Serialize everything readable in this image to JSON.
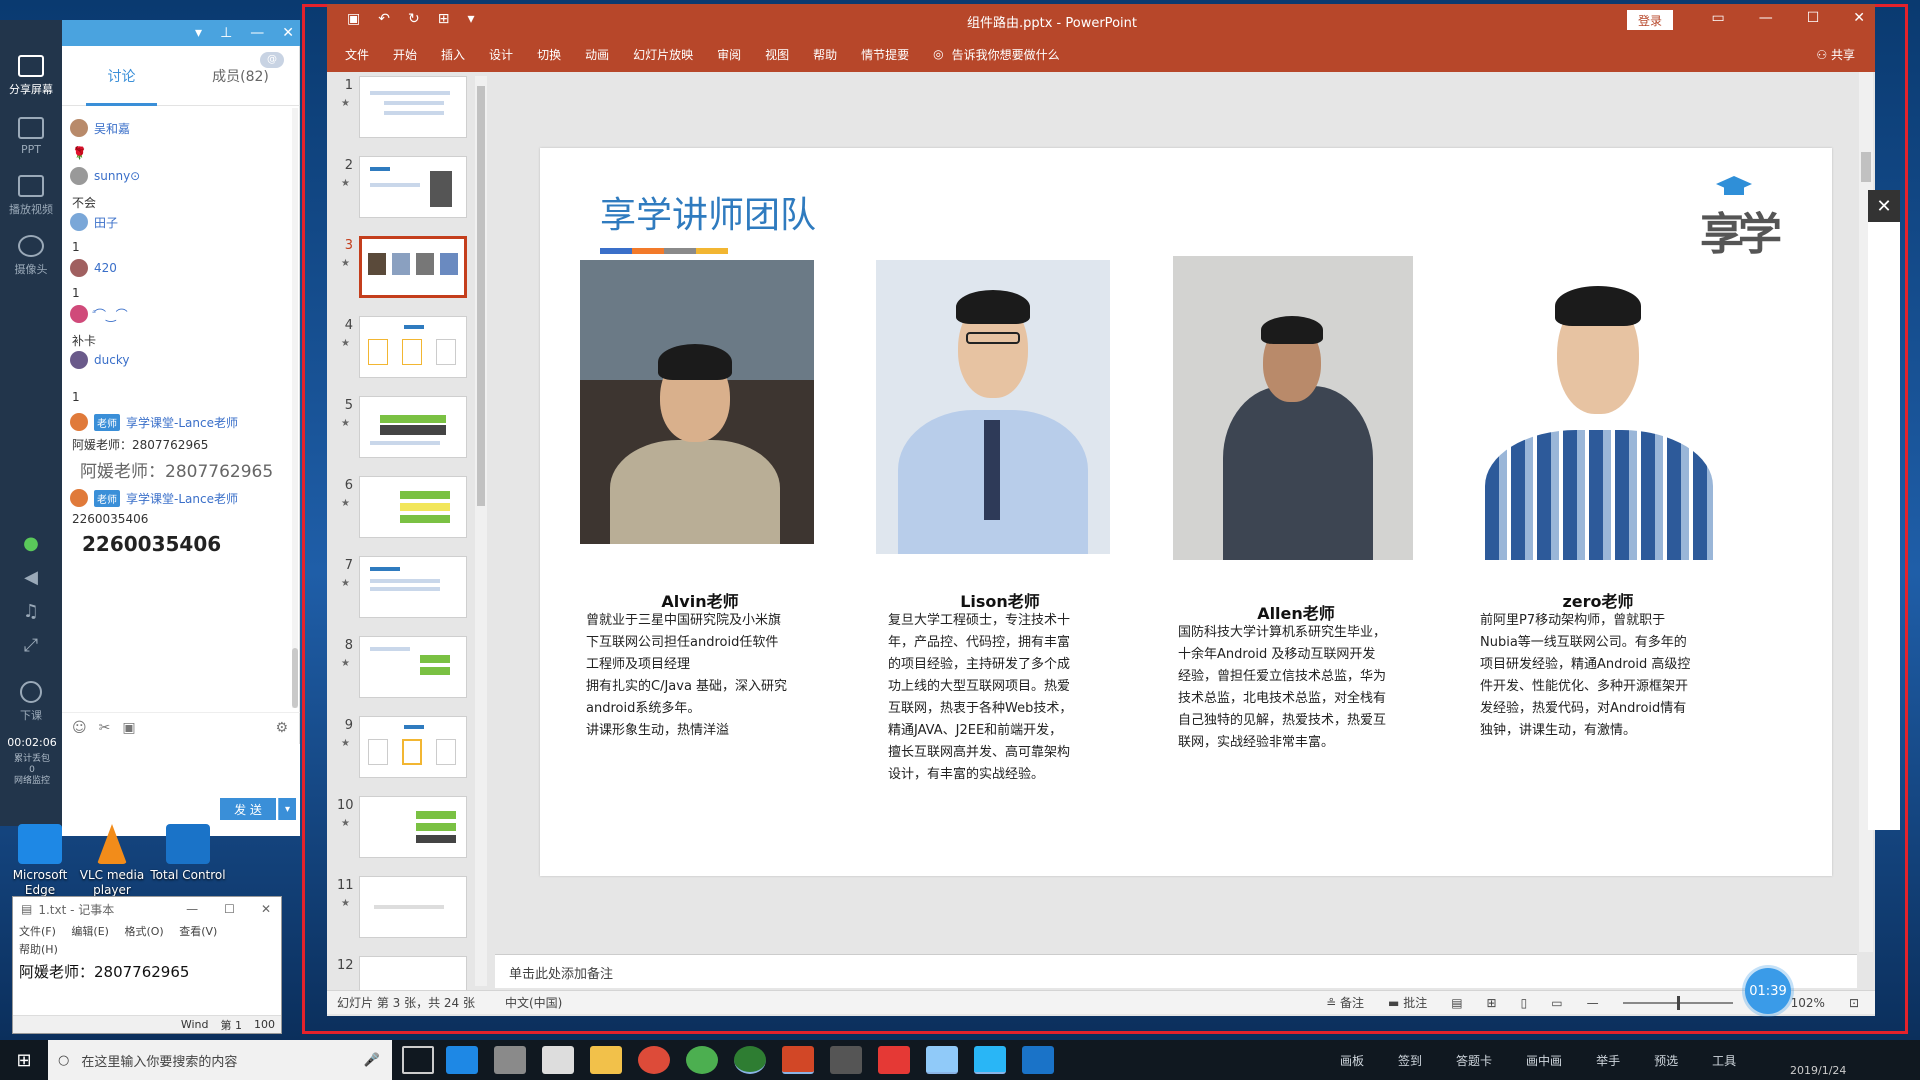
{
  "classroom": {
    "rail": [
      {
        "label": "分享屏幕",
        "icon": "share-screen-icon",
        "active": true
      },
      {
        "label": "PPT",
        "icon": "ppt-icon"
      },
      {
        "label": "播放视频",
        "icon": "play-video-icon"
      },
      {
        "label": "摄像头",
        "icon": "camera-icon"
      }
    ],
    "rail_small_icons": [
      "mic-icon",
      "speaker-icon",
      "music-icon",
      "expand-icon"
    ],
    "end_class_label": "下课",
    "timer": "00:02:06",
    "stats_line1": "累计丢包",
    "stats_line2": "0",
    "stats_line3": "网络监控",
    "tabs": {
      "discussion": "讨论",
      "members": "成员(82)",
      "badge": "@"
    },
    "messages": [
      {
        "user": "吴和嘉",
        "text": "🌹"
      },
      {
        "user": "sunny⊙",
        "text": "不会"
      },
      {
        "user": "田子",
        "text": "1"
      },
      {
        "user": "420",
        "text": "1"
      },
      {
        "user": "ꜙ⌒‿⌒",
        "text": "补卡"
      },
      {
        "user": "ducky",
        "text": "1"
      },
      {
        "user": "享学课堂-Lance老师",
        "tag": "老师",
        "text": "阿媛老师：2807762965",
        "big": "阿媛老师：2807762965"
      },
      {
        "user": "享学课堂-Lance老师",
        "tag": "老师",
        "text": "2260035406",
        "big": "2260035406"
      }
    ],
    "send_label": "发 送",
    "send_dropdown": "▾"
  },
  "desktop_icons": [
    {
      "label": "Microsoft Edge",
      "color": "#1e88e5"
    },
    {
      "label": "VLC media player",
      "color": "#f28c1a"
    },
    {
      "label": "Total Control",
      "color": "#1a73c8"
    }
  ],
  "notepad": {
    "title": "1.txt - 记事本",
    "menus": [
      "文件(F)",
      "编辑(E)",
      "格式(O)",
      "查看(V)",
      "帮助(H)"
    ],
    "content": "阿媛老师：2807762965",
    "status_enc": "Wind",
    "status_pos": "第 1",
    "status_zoom": "100"
  },
  "ppt": {
    "title": "组件路由.pptx  -  PowerPoint",
    "login": "登录",
    "tabs": [
      "文件",
      "开始",
      "插入",
      "设计",
      "切换",
      "动画",
      "幻灯片放映",
      "审阅",
      "视图",
      "帮助",
      "情节提要"
    ],
    "tell_me": "告诉我你想要做什么",
    "share": "共享",
    "slide_numbers": [
      "1",
      "2",
      "3",
      "4",
      "5",
      "6",
      "7",
      "8",
      "9",
      "10",
      "11",
      "12"
    ],
    "selected_slide": "3",
    "notes_placeholder": "单击此处添加备注",
    "status_slide": "幻灯片 第 3 张，共 24 张",
    "status_lang": "中文(中国)",
    "status_notes": "备注",
    "status_comments": "批注",
    "zoom": "102%",
    "timer": "01:39"
  },
  "slide": {
    "title": "享学讲师团队",
    "logo_text": "享学",
    "title_bar_colors": [
      "#3a6fc9",
      "#f27a2a",
      "#8a8a8a",
      "#f2b632"
    ],
    "teachers": [
      {
        "name": "Alvin老师",
        "desc": [
          "曾就业于三星中国研究院及小米旗",
          "下互联网公司担任android任软件",
          "工程师及项目经理",
          "拥有扎实的C/Java 基础，深入研究",
          "android系统多年。",
          "讲课形象生动，热情洋溢"
        ]
      },
      {
        "name": "Lison老师",
        "desc": [
          "复旦大学工程硕士，专注技术十",
          "年，产品控、代码控，拥有丰富",
          "的项目经验，主持研发了多个成",
          "功上线的大型互联网项目。热爱",
          "互联网，热衷于各种Web技术，",
          "精通JAVA、J2EE和前端开发，",
          "擅长互联网高并发、高可靠架构",
          "设计，有丰富的实战经验。"
        ]
      },
      {
        "name": "Allen老师",
        "desc": [
          "国防科技大学计算机系研究生毕业，",
          "十余年Android 及移动互联网开发",
          "经验，曾担任爱立信技术总监，华为",
          "技术总监，北电技术总监，对全栈有",
          "自己独特的见解，热爱技术，热爱互",
          "联网，实战经验非常丰富。"
        ]
      },
      {
        "name": "zero老师",
        "desc": [
          "前阿里P7移动架构师，曾就职于",
          "Nubia等一线互联网公司。有多年的",
          "项目研发经验，精通Android 高级控",
          "件开发、性能优化、多种开源框架开",
          "发经验，热爱代码，对Android情有",
          "独钟，讲课生动，有激情。"
        ]
      }
    ]
  },
  "taskbar": {
    "search_placeholder": "在这里输入你要搜索的内容",
    "tools": [
      "画板",
      "签到",
      "答题卡",
      "画中画",
      "举手",
      "预选",
      "工具"
    ],
    "date": "2019/1/24"
  }
}
